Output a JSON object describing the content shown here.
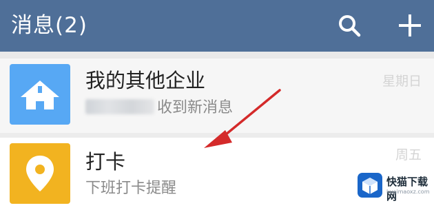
{
  "header": {
    "title": "消息(2)",
    "search_icon": "search-icon",
    "add_icon": "plus-icon",
    "background_color": "#4f6f98"
  },
  "conversations": [
    {
      "title": "我的其他企业",
      "subtitle": "收到新消息",
      "time": "星期日",
      "icon": "home-icon",
      "avatar_color": "#57a8f4"
    },
    {
      "title": "打卡",
      "subtitle": "下班打卡提醒",
      "time": "周五",
      "icon": "location-pin-icon",
      "avatar_color": "#f2b320"
    }
  ],
  "annotation": {
    "icon": "red-arrow-icon",
    "color": "#d42a2a"
  },
  "watermark": {
    "name": "快猫下载网",
    "url": "kuaimaoxz.com"
  }
}
